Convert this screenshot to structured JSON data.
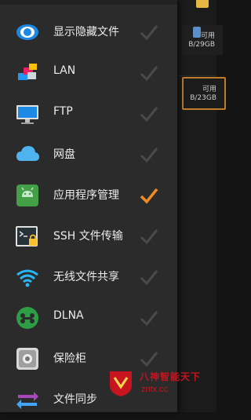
{
  "drawer": {
    "items": [
      {
        "label": "显示隐藏文件",
        "icon": "eye-icon",
        "checked": false
      },
      {
        "label": "LAN",
        "icon": "lan-icon",
        "checked": false
      },
      {
        "label": "FTP",
        "icon": "monitor-icon",
        "checked": false
      },
      {
        "label": "网盘",
        "icon": "cloud-icon",
        "checked": false
      },
      {
        "label": "应用程序管理",
        "icon": "android-icon",
        "checked": true
      },
      {
        "label": "SSH 文件传输",
        "icon": "terminal-lock-icon",
        "checked": false
      },
      {
        "label": "无线文件共享",
        "icon": "wifi-icon",
        "checked": false
      },
      {
        "label": "DLNA",
        "icon": "dlna-icon",
        "checked": false
      },
      {
        "label": "保险柜",
        "icon": "safe-icon",
        "checked": false
      },
      {
        "label": "文件同步",
        "icon": "sync-arrows-icon",
        "checked": false
      }
    ]
  },
  "background": {
    "storage1": {
      "line1": "可用",
      "line2": "B/29GB"
    },
    "storage2": {
      "line1": "可用",
      "line2": "B/23GB"
    }
  },
  "watermark": {
    "title": "八神智能天下",
    "url": "zntx.cc"
  },
  "colors": {
    "accent": "#f08a24",
    "check_inactive": "#4a4a4a",
    "drawer_bg": "#2b2b2b"
  }
}
